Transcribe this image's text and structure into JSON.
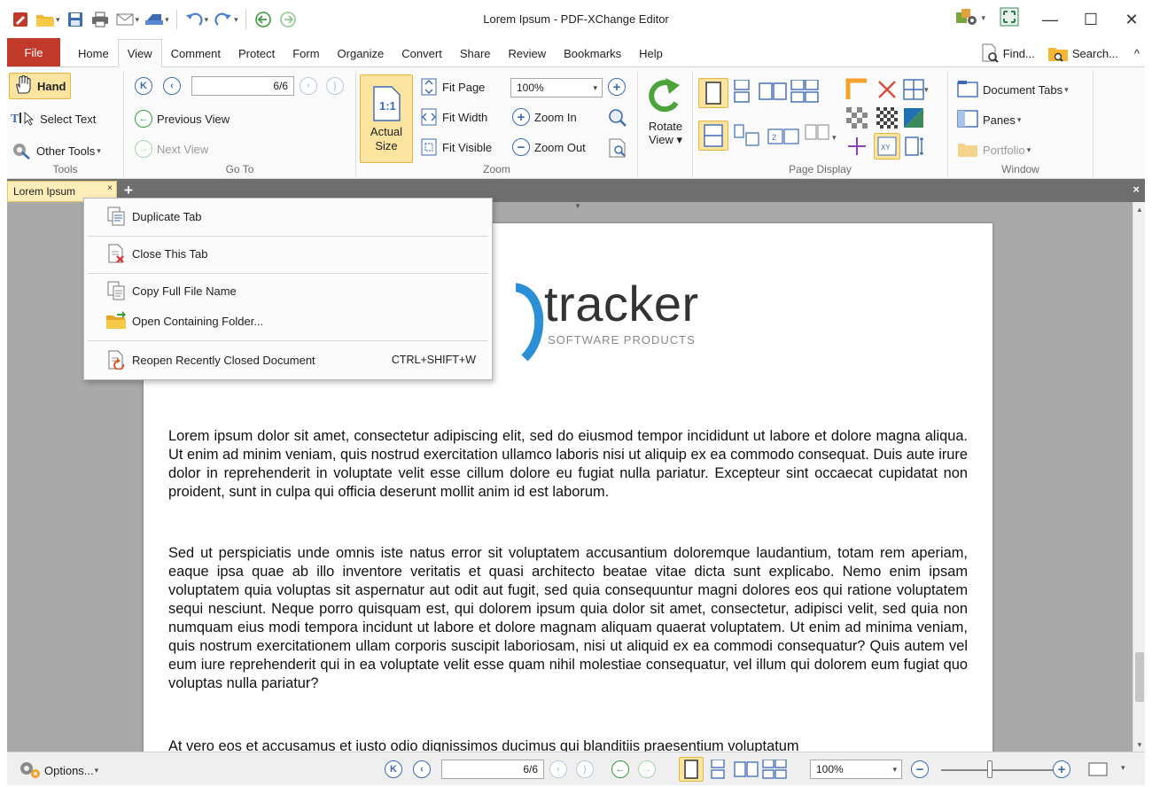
{
  "window": {
    "title": "Lorem Ipsum - PDF-XChange Editor",
    "minimize": "—",
    "maximize": "☐",
    "close": "✕"
  },
  "tabs": {
    "file": "File",
    "home": "Home",
    "view": "View",
    "comment": "Comment",
    "protect": "Protect",
    "form": "Form",
    "organize": "Organize",
    "convert": "Convert",
    "share": "Share",
    "review": "Review",
    "bookmarks": "Bookmarks",
    "help": "Help",
    "find": "Find...",
    "search": "Search...",
    "collapse": "^"
  },
  "ribbon": {
    "tools": {
      "label": "Tools",
      "hand": "Hand",
      "select_text": "Select Text",
      "other_tools": "Other Tools"
    },
    "goto": {
      "label": "Go To",
      "page_value": "6/6",
      "previous_view": "Previous View",
      "next_view": "Next View"
    },
    "zoom": {
      "label": "Zoom",
      "actual_size_line1": "Actual",
      "actual_size_line2": "Size",
      "fit_page": "Fit Page",
      "fit_width": "Fit Width",
      "fit_visible": "Fit Visible",
      "zoom_value": "100%",
      "zoom_in": "Zoom In",
      "zoom_out": "Zoom Out"
    },
    "rotate": {
      "line1": "Rotate",
      "line2": "View"
    },
    "page_display": {
      "label": "Page Display"
    },
    "window": {
      "label": "Window",
      "document_tabs": "Document Tabs",
      "panes": "Panes",
      "portfolio": "Portfolio"
    }
  },
  "doc_tab": {
    "name": "Lorem Ipsum",
    "close": "×",
    "new": "+",
    "close_all": "×"
  },
  "context_menu": {
    "duplicate_tab": "Duplicate Tab",
    "close_this_tab": "Close This Tab",
    "copy_full_file_name": "Copy Full File Name",
    "open_containing_folder": "Open Containing Folder...",
    "reopen_recently_closed": "Reopen Recently Closed Document",
    "reopen_shortcut": "CTRL+SHIFT+W"
  },
  "document": {
    "logo_word": "tracker",
    "logo_sub": "SOFTWARE PRODUCTS",
    "paragraph1": "Lorem ipsum dolor sit amet, consectetur adipiscing elit, sed do eiusmod tempor incididunt ut labore et dolore magna aliqua. Ut enim ad minim veniam, quis nostrud exercitation ullamco laboris nisi ut aliquip ex ea commodo consequat. Duis aute irure dolor in reprehenderit in voluptate velit esse cillum dolore eu fugiat nulla pariatur. Excepteur sint occaecat cupidatat non proident, sunt in culpa qui officia deserunt mollit anim id est laborum.",
    "paragraph2": "Sed ut perspiciatis unde omnis iste natus error sit voluptatem accusantium doloremque laudantium, totam rem aperiam, eaque ipsa quae ab illo inventore veritatis et quasi architecto beatae vitae dicta sunt explicabo. Nemo enim ipsam voluptatem quia voluptas sit aspernatur aut odit aut fugit, sed quia consequuntur magni dolores eos qui ratione voluptatem sequi nesciunt. Neque porro quisquam est, qui dolorem ipsum quia dolor sit amet, consectetur, adipisci velit, sed quia non numquam eius modi tempora incidunt ut labore et dolore magnam aliquam quaerat voluptatem. Ut enim ad minima veniam, quis nostrum exercitationem ullam corporis suscipit laboriosam, nisi ut aliquid ex ea commodi consequatur? Quis autem vel eum iure reprehenderit qui in ea voluptate velit esse quam nihil molestiae consequatur, vel illum qui dolorem eum fugiat quo voluptas nulla pariatur?",
    "paragraph3": "At vero eos et accusamus et iusto odio dignissimos ducimus qui blanditiis praesentium voluptatum"
  },
  "statusbar": {
    "options": "Options...",
    "page_value": "6/6",
    "zoom_value": "100%"
  },
  "colors": {
    "file_tab": "#c0392b",
    "highlight": "#fbe4a0",
    "accent_blue": "#3d6ab3",
    "canvas_gray": "#a9a9a9"
  }
}
